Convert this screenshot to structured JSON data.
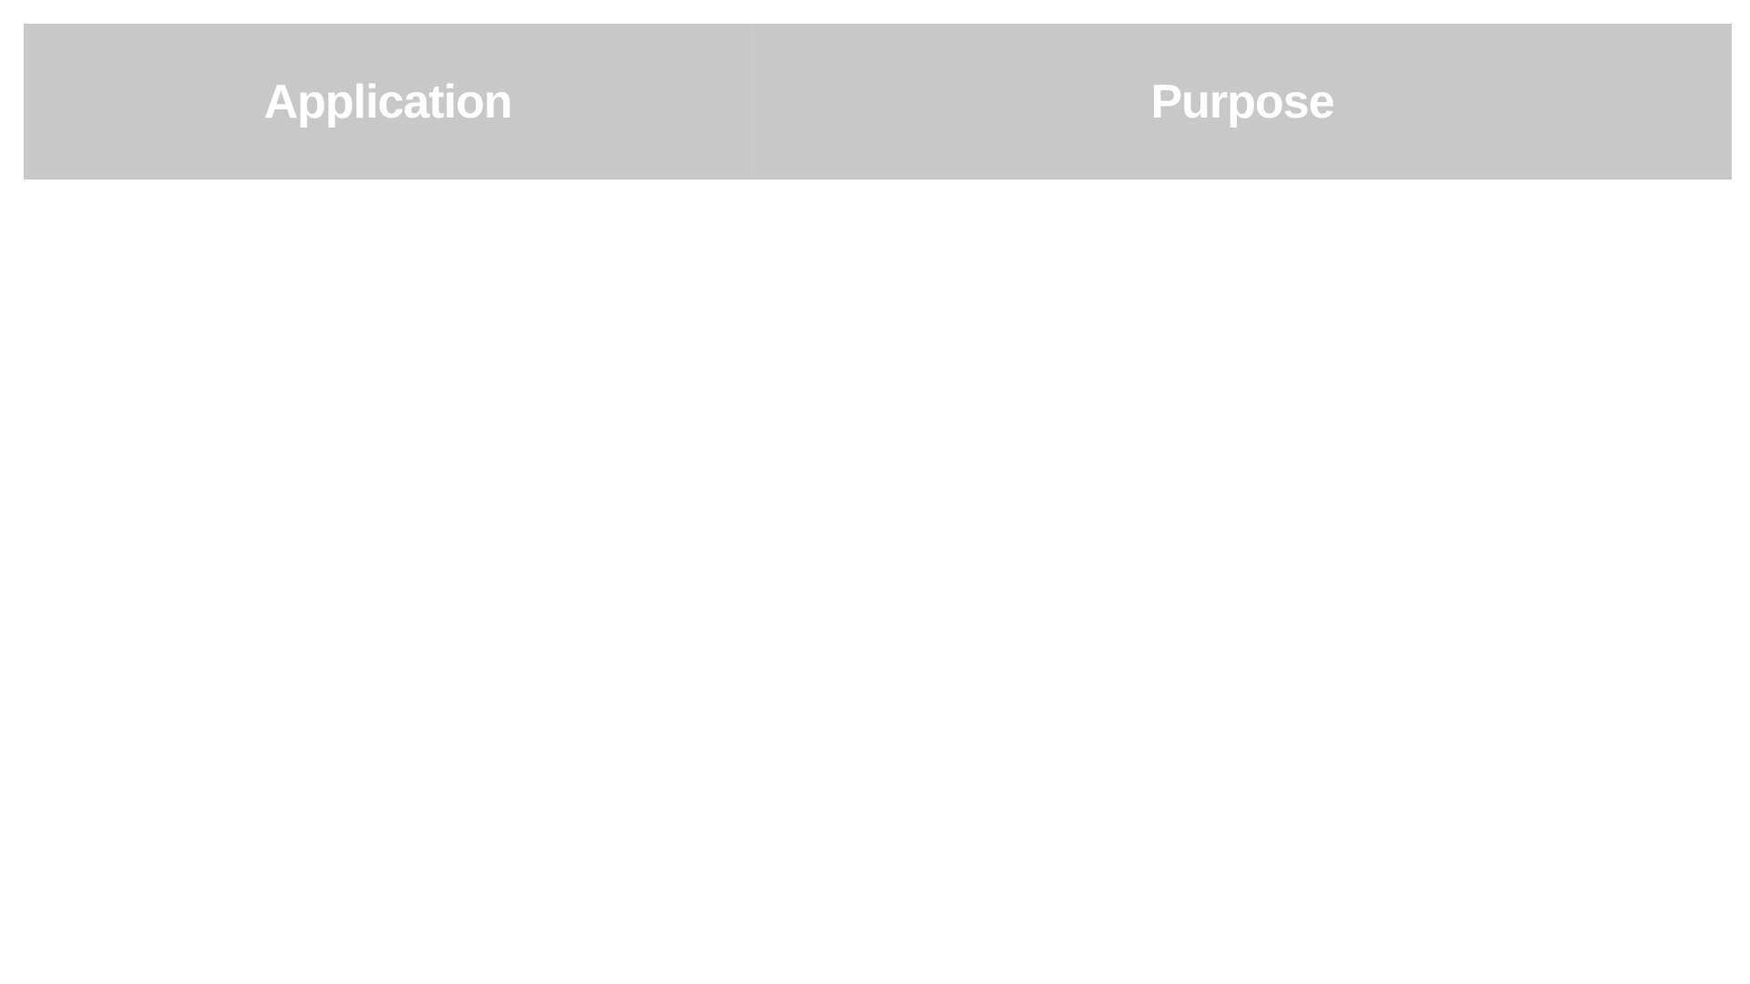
{
  "table": {
    "columns": [
      {
        "label": "Application"
      },
      {
        "label": "Purpose"
      }
    ],
    "rows": []
  },
  "colors": {
    "header_background": "#c8c8c8",
    "header_text": "#ffffff",
    "page_background": "#fefefe"
  }
}
